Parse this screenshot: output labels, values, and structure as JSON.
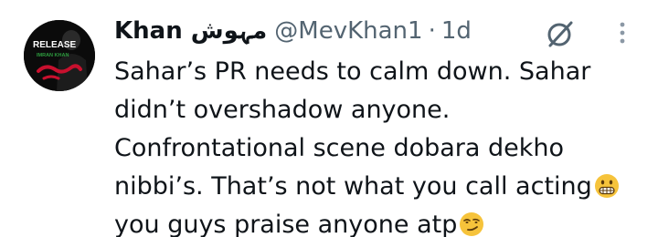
{
  "tweet": {
    "display_name": "Khan مہوش",
    "handle": "@MevKhan1",
    "separator": "·",
    "time": "1d",
    "avatar": {
      "line1": "RELEASE",
      "line2": "IMRAN KHAN"
    },
    "lines": [
      "Sahar’s PR needs to calm down. Sahar",
      "didn’t overshadow anyone.",
      "Confrontational scene dobara dekho",
      "nibbi’s. That’s not what you call acting",
      "you guys praise anyone atp"
    ],
    "emojis": [
      "grimacing-face-emoji",
      "smirking-face-emoji"
    ],
    "icons": [
      "grok-icon",
      "more-icon"
    ],
    "colors": {
      "text": "#0f1419",
      "secondary": "#536471",
      "emoji": "#f6c33b",
      "avatar_bg": "#0b0b0b",
      "avatar_accent": "#c8102e",
      "avatar_text2": "#2e9c3f"
    }
  }
}
